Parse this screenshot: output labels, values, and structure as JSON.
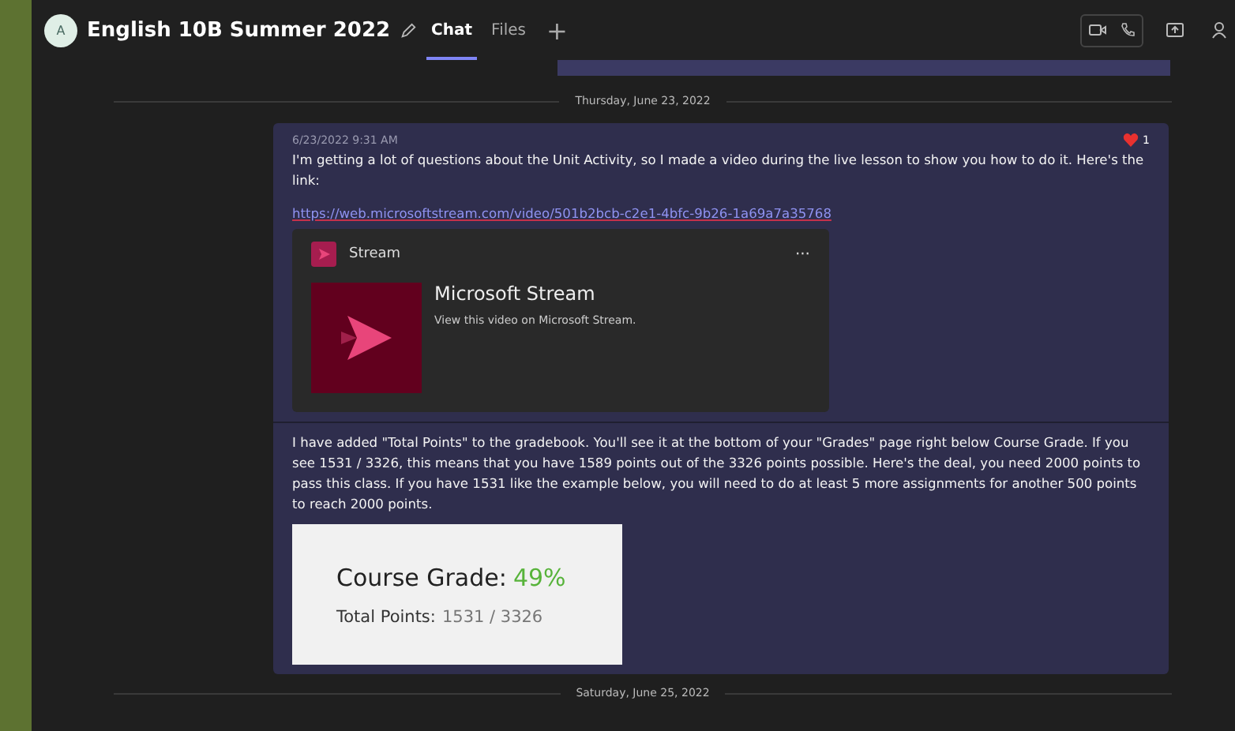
{
  "header": {
    "avatar_initials": "A",
    "title": "English 10B Summer 2022",
    "tabs": [
      {
        "label": "Chat",
        "selected": true
      },
      {
        "label": "Files",
        "selected": false
      }
    ],
    "add_tab": "+"
  },
  "dates": [
    "Thursday, June 23, 2022",
    "Saturday, June 25, 2022"
  ],
  "message": {
    "timestamp": "6/23/2022 9:31 AM",
    "reaction_count": "1",
    "text": "I'm getting a lot of questions about the Unit Activity, so I made a video during the live lesson to show you how to do it. Here's the link:",
    "link": "https://web.microsoftstream.com/video/501b2bcb-c2e1-4bfc-9b26-1a69a7a35768",
    "card": {
      "source": "Stream",
      "more": "···",
      "title": "Microsoft Stream",
      "description": "View this video on Microsoft Stream."
    }
  },
  "followup": {
    "text": "I have added \"Total Points\" to the gradebook. You'll see it at the bottom of your \"Grades\" page right below Course Grade. If you see 1531 / 3326, this means that you have 1589 points out of the 3326 points possible. Here's the deal, you need 2000 points to pass this class. If you have 1531 like the example below, you will need to do at least 5 more assignments for another 500 points to reach 2000 points.",
    "image": {
      "grade_label": "Course Grade:",
      "grade_value": "49%",
      "points_label": "Total Points:",
      "points_value": "1531 / 3326"
    }
  }
}
